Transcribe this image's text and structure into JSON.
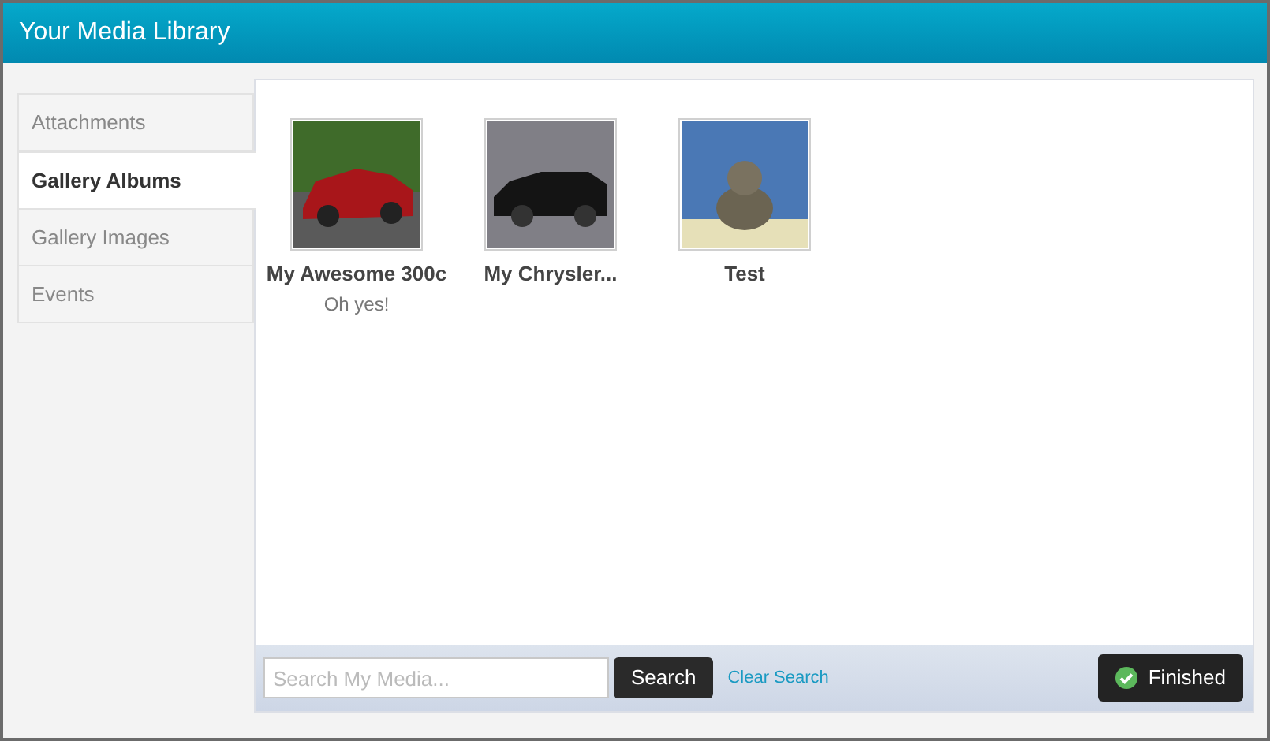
{
  "window": {
    "title": "Your Media Library"
  },
  "sidebar": {
    "items": [
      {
        "label": "Attachments",
        "selected": false
      },
      {
        "label": "Gallery Albums",
        "selected": true
      },
      {
        "label": "Gallery Images",
        "selected": false
      },
      {
        "label": "Events",
        "selected": false
      }
    ]
  },
  "albums": [
    {
      "title": "My Awesome 300c",
      "subtitle": "Oh yes!"
    },
    {
      "title": "My Chrysler..."
    },
    {
      "title": "Test"
    }
  ],
  "footer": {
    "search": {
      "placeholder": "Search My Media..."
    },
    "search_button": "Search",
    "clear_link": "Clear Search",
    "finished_button": "Finished"
  }
}
